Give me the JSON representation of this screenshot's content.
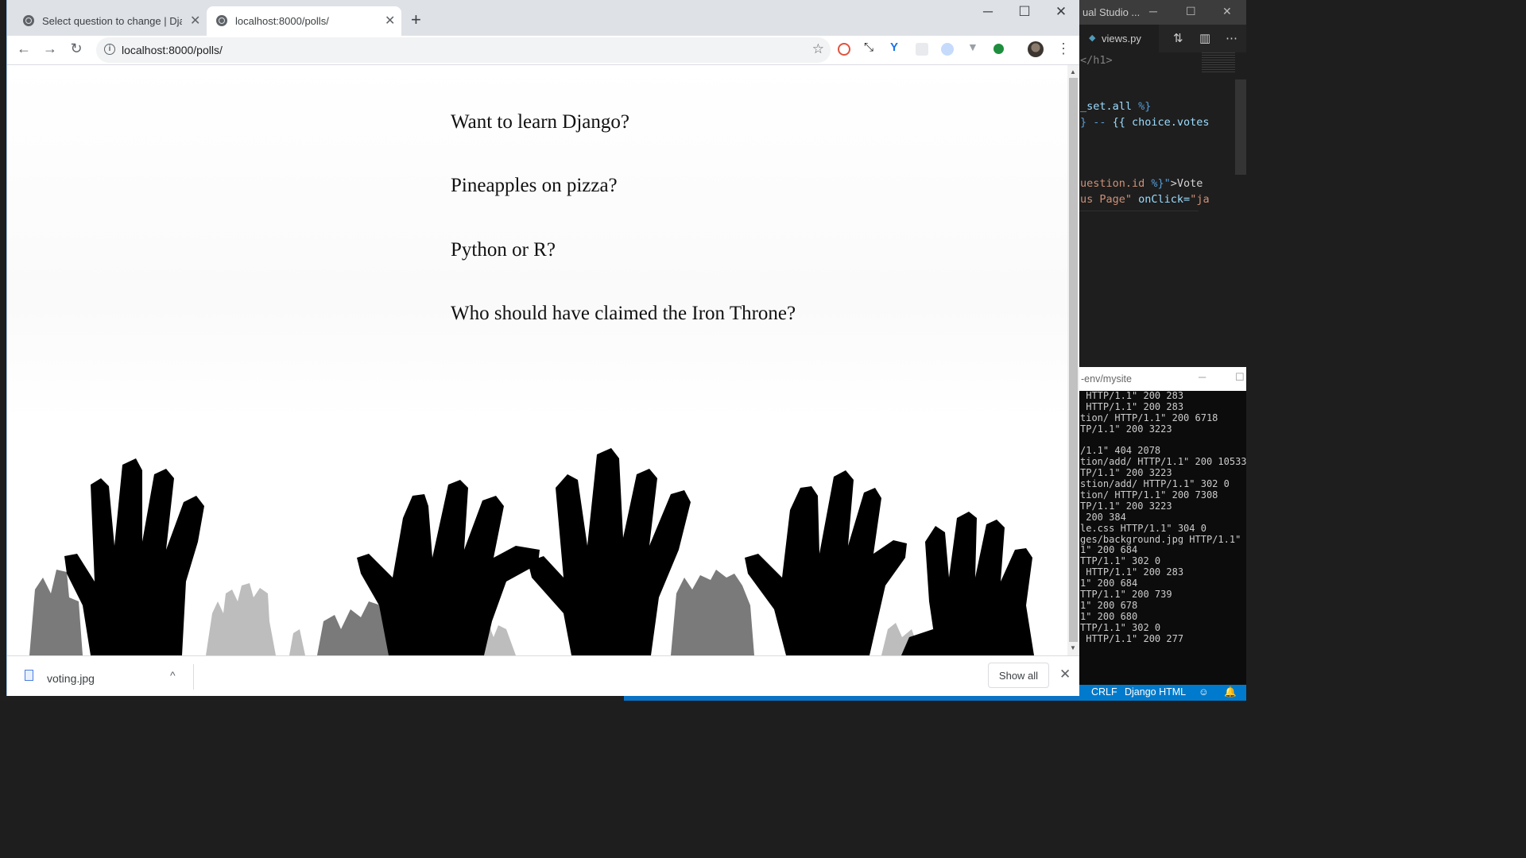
{
  "browser": {
    "tabs": [
      {
        "title": "Select question to change | Djang",
        "close": "✕"
      },
      {
        "title": "localhost:8000/polls/",
        "close": "✕"
      }
    ],
    "new_tab": "+",
    "window_controls": {
      "minimize": "─",
      "maximize": "☐",
      "close": "✕"
    },
    "nav": {
      "back": "←",
      "forward": "→",
      "reload": "↻"
    },
    "address_bar": {
      "url": "localhost:8000/polls/",
      "info": "i",
      "bookmark": "☆"
    },
    "menu": "⋮",
    "extensions": [
      {
        "icon": "extension-red-icon",
        "color": "#e0533f"
      },
      {
        "icon": "extension-arrows-icon",
        "color": "#202124"
      },
      {
        "icon": "extension-v-blue-icon",
        "color": "#1a73e8"
      },
      {
        "icon": "extension-grey-icon",
        "color": "#e8eaed"
      },
      {
        "icon": "extension-blue-circle-icon",
        "color": "#8ab4f8"
      },
      {
        "icon": "extension-v-grey-icon",
        "color": "#9aa0a6"
      },
      {
        "icon": "extension-green-dot-icon",
        "color": "#1e8e3e"
      }
    ]
  },
  "page": {
    "questions": [
      "Want to learn Django?",
      "Pineapples on pizza?",
      "Python or R?",
      "Who should have claimed the Iron Throne?"
    ]
  },
  "download_bar": {
    "file_name": "voting.jpg",
    "chevron": "^",
    "show_all": "Show all",
    "close": "✕"
  },
  "vscode": {
    "title": "ual Studio ...",
    "tab": "views.py",
    "code_lines": {
      "l1": "</h1>",
      "l2_a": "_set.all ",
      "l2_b": "%}",
      "l3_a": "} -- ",
      "l3_b": "{{ choice.votes",
      "l4_a": "uestion.id ",
      "l4_b": "%}\"",
      "l4_c": ">Vote",
      "l5_a": "us Page\"",
      "l5_b": " onClick=",
      "l5_c": "\"ja"
    }
  },
  "terminal": {
    "title": "-env/mysite",
    "lines": [
      " HTTP/1.1\" 200 283",
      " HTTP/1.1\" 200 283",
      "tion/ HTTP/1.1\" 200 6718",
      "TP/1.1\" 200 3223",
      "",
      "/1.1\" 404 2078",
      "tion/add/ HTTP/1.1\" 200 10533",
      "TP/1.1\" 200 3223",
      "stion/add/ HTTP/1.1\" 302 0",
      "tion/ HTTP/1.1\" 200 7308",
      "TP/1.1\" 200 3223",
      " 200 384",
      "le.css HTTP/1.1\" 304 0",
      "ges/background.jpg HTTP/1.1\"",
      "1\" 200 684",
      "TTP/1.1\" 302 0",
      " HTTP/1.1\" 200 283",
      "1\" 200 684",
      "TTP/1.1\" 200 739",
      "1\" 200 678",
      "1\" 200 680",
      "TTP/1.1\" 302 0",
      " HTTP/1.1\" 200 277"
    ]
  },
  "statusbar": {
    "eol": "CRLF",
    "language": "Django HTML"
  },
  "colors": {
    "vscode_status": "#007acc",
    "tab_bar": "#dee1e6",
    "hands_dark": "#000000",
    "hands_mid": "#7a7a7a",
    "hands_light": "#bdbdbd"
  }
}
